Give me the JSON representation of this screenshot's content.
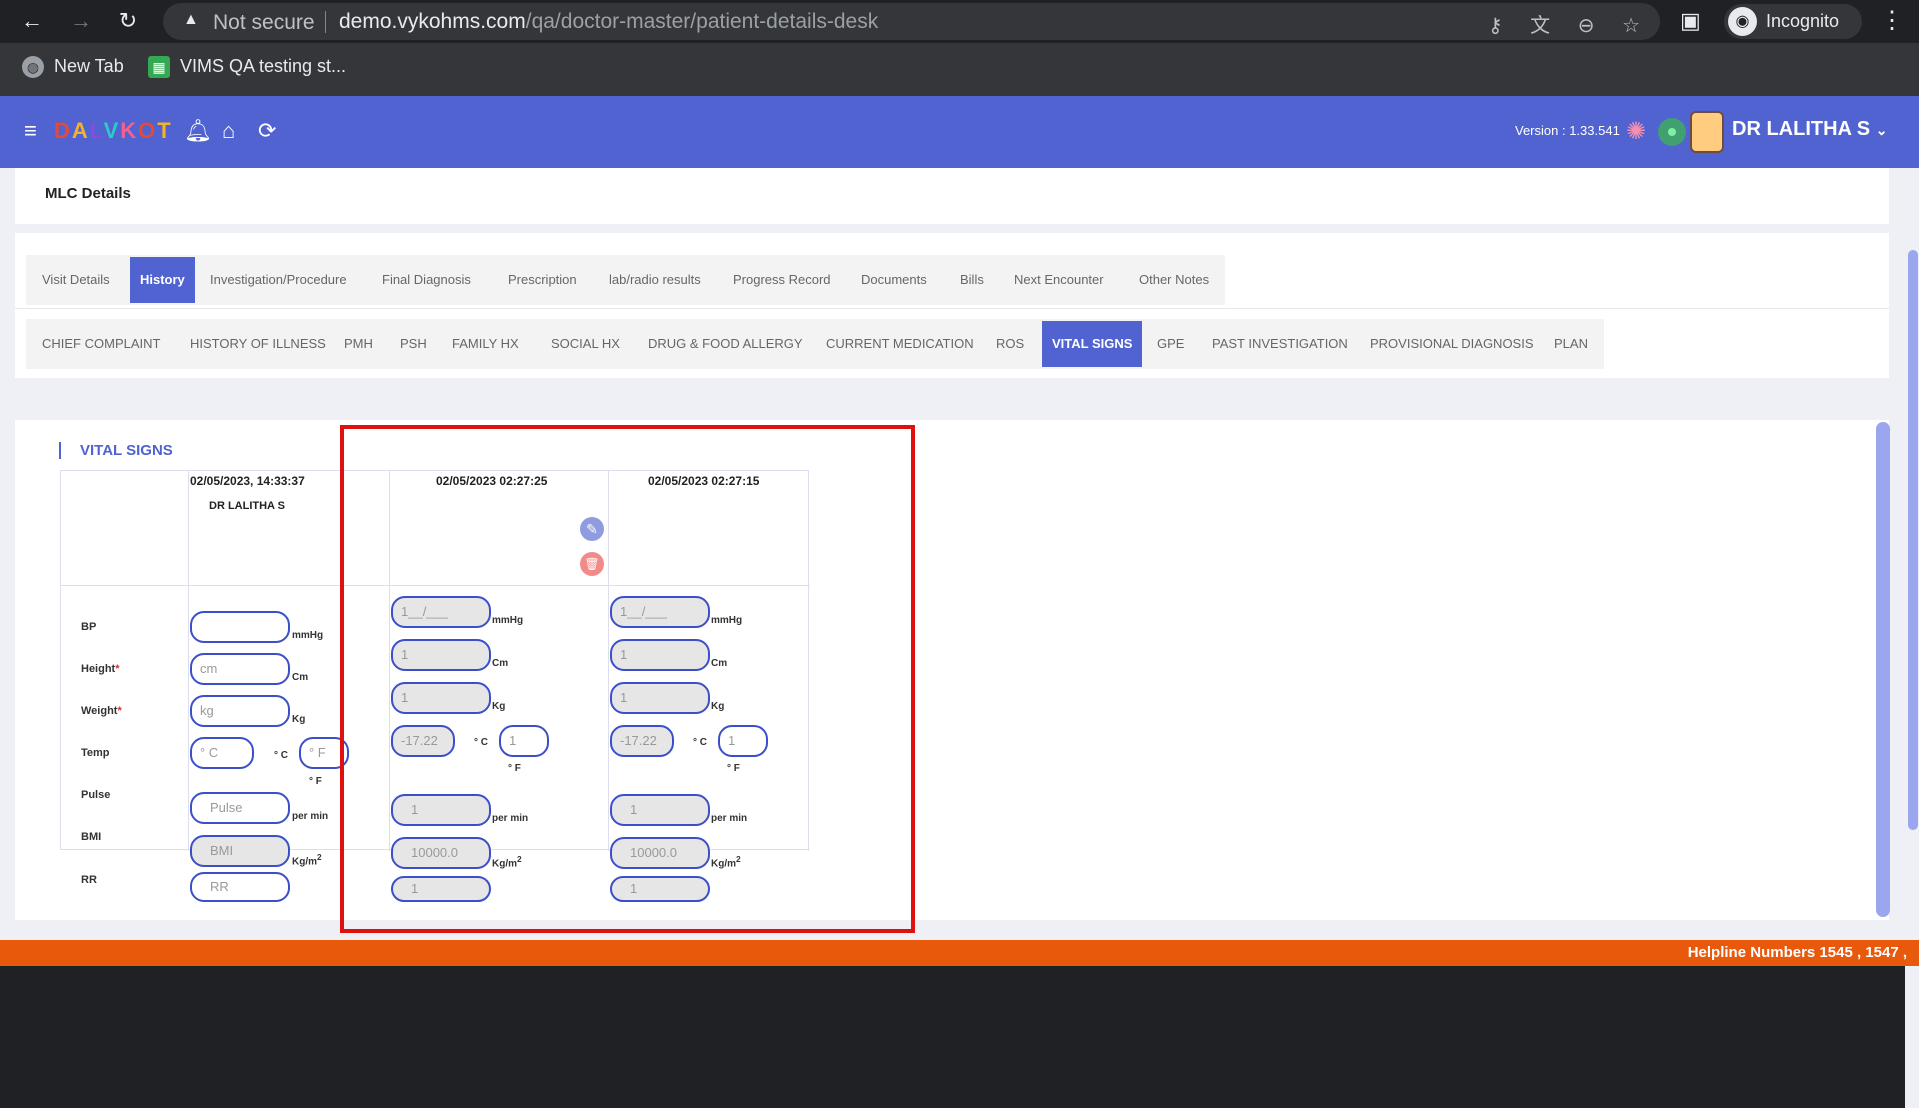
{
  "browser": {
    "omnibox": {
      "security_label": "Not secure",
      "url_host": "demo.vykohms.com",
      "url_path": "/qa/doctor-master/patient-details-desk"
    },
    "profile_label": "Incognito",
    "bookmarks": [
      {
        "label": "New Tab",
        "icon": "globe-icon"
      },
      {
        "label": "VIMS QA testing st...",
        "icon": "sheet-icon"
      }
    ]
  },
  "app": {
    "logo_letters": [
      "D",
      "A",
      "L",
      "V",
      "K",
      "O",
      "T"
    ],
    "version": "Version : 1.33.541",
    "doctor_name": "DR LALITHA S"
  },
  "mlc": {
    "title": "MLC Details"
  },
  "main_tabs": [
    {
      "label": "Visit Details",
      "active": false
    },
    {
      "label": "History",
      "active": true
    },
    {
      "label": "Investigation/Procedure",
      "active": false
    },
    {
      "label": "Final Diagnosis",
      "active": false
    },
    {
      "label": "Prescription",
      "active": false
    },
    {
      "label": "lab/radio results",
      "active": false
    },
    {
      "label": "Progress Record",
      "active": false
    },
    {
      "label": "Documents",
      "active": false
    },
    {
      "label": "Bills",
      "active": false
    },
    {
      "label": "Next Encounter",
      "active": false
    },
    {
      "label": "Other Notes",
      "active": false
    }
  ],
  "history_tabs": [
    {
      "label": "CHIEF COMPLAINT",
      "active": false
    },
    {
      "label": "HISTORY OF ILLNESS",
      "active": false
    },
    {
      "label": "PMH",
      "active": false
    },
    {
      "label": "PSH",
      "active": false
    },
    {
      "label": "FAMILY HX",
      "active": false
    },
    {
      "label": "SOCIAL HX",
      "active": false
    },
    {
      "label": "DRUG & FOOD ALLERGY",
      "active": false
    },
    {
      "label": "CURRENT MEDICATION",
      "active": false
    },
    {
      "label": "ROS",
      "active": false
    },
    {
      "label": "VITAL SIGNS",
      "active": true
    },
    {
      "label": "GPE",
      "active": false
    },
    {
      "label": "PAST INVESTIGATION",
      "active": false
    },
    {
      "label": "PROVISIONAL DIAGNOSIS",
      "active": false
    },
    {
      "label": "PLAN",
      "active": false
    }
  ],
  "vital_signs": {
    "title": "VITAL SIGNS",
    "row_labels": {
      "bp": "BP",
      "height": "Height",
      "weight": "Weight",
      "temp": "Temp",
      "pulse": "Pulse",
      "bmi": "BMI",
      "rr": "RR",
      "required_mark": "*"
    },
    "units": {
      "bp": "mmHg",
      "height": "Cm",
      "weight": "Kg",
      "celsius": "° C",
      "fahrenheit": "° F",
      "pulse": "per min",
      "bmi": "Kg/m",
      "bmi_sup": "2",
      "rr": "per min"
    },
    "new_entry": {
      "timestamp": "02/05/2023, 14:33:37",
      "doctor": "DR LALITHA S",
      "placeholders": {
        "bp": "",
        "height": "cm",
        "weight": "kg",
        "temp_c": "° C",
        "temp_f": "° F",
        "pulse": "Pulse",
        "bmi": "BMI",
        "rr": "RR"
      }
    },
    "records": [
      {
        "timestamp": "02/05/2023 02:27:25",
        "bp": "1__/___",
        "height": "1",
        "weight": "1",
        "temp_c": "-17.22",
        "temp_f": "1",
        "pulse": "1",
        "bmi": "10000.0",
        "rr": "1"
      },
      {
        "timestamp": "02/05/2023 02:27:15",
        "bp": "1__/___",
        "height": "1",
        "weight": "1",
        "temp_c": "-17.22",
        "temp_f": "1",
        "pulse": "1",
        "bmi": "10000.0",
        "rr": "1"
      }
    ]
  },
  "footer": {
    "helpline": "Helpline Numbers 1545 , 1547 ,"
  },
  "colors": {
    "brand": "#5063d0",
    "highlight": "#e0100f",
    "footer": "#e8590c"
  }
}
